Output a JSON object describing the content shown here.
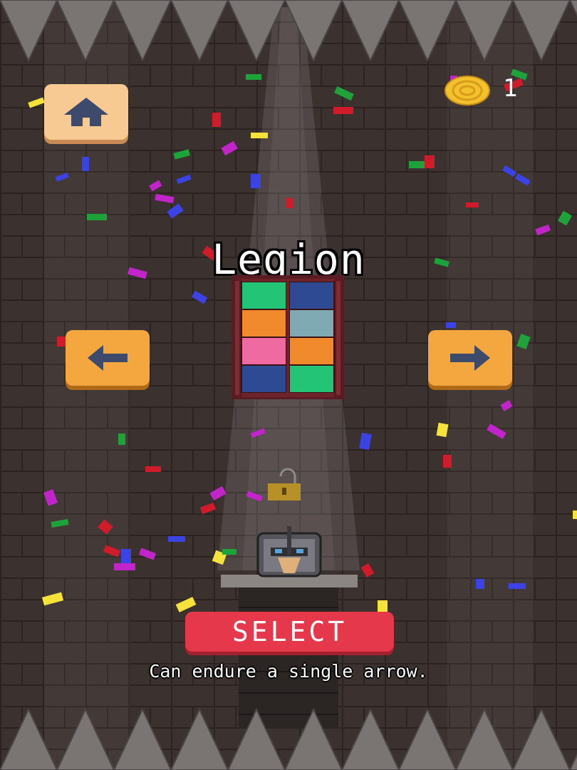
{
  "coins": {
    "icon": "gold-coin-icon",
    "count": "1"
  },
  "buttons": {
    "home_icon": "home-icon",
    "prev_icon": "arrow-left-icon",
    "next_icon": "arrow-right-icon",
    "select_label": "SELECT"
  },
  "character": {
    "name": "Legion",
    "description": "Can endure a single arrow.",
    "window_colors": [
      "#24c477",
      "#2e4a93",
      "#f08a2c",
      "#7faab3",
      "#ef6aa0",
      "#f08a2c",
      "#2e4a93",
      "#24c477"
    ]
  },
  "colors": {
    "button_orange": "#f4a63f",
    "home_button": "#f7c993",
    "select_red": "#e5394b",
    "wall": "#3b3230"
  }
}
